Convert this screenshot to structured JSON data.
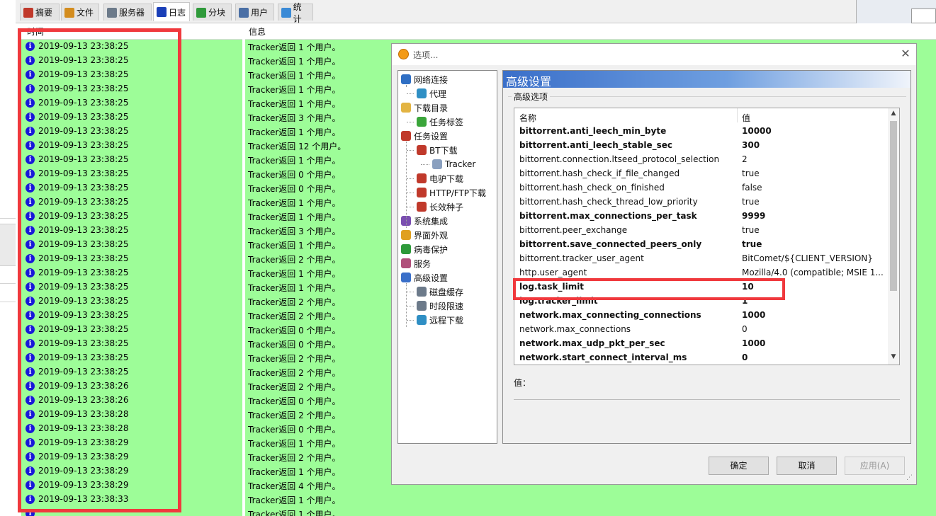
{
  "tabs": [
    {
      "label": "摘要",
      "icon": "checklist-icon",
      "color": "#c0392b"
    },
    {
      "label": "文件",
      "icon": "file-icon",
      "color": "#d38c1e"
    },
    {
      "label": "服务器",
      "icon": "server-icon",
      "color": "#6c7a8a"
    },
    {
      "label": "日志",
      "icon": "info-icon",
      "color": "#1a3fb8",
      "active": true
    },
    {
      "label": "分块",
      "icon": "pie-chart-icon",
      "color": "#2f9a3a"
    },
    {
      "label": "用户",
      "icon": "user-icon",
      "color": "#4a6fa5"
    },
    {
      "label": "统计",
      "icon": "stats-icon",
      "color": "#3a8ad6"
    }
  ],
  "log": {
    "columns": {
      "time": "时间",
      "message": "信息"
    },
    "rows": [
      {
        "time": "2019-09-13 23:38:25",
        "message": "Tracker返回 1 个用户。"
      },
      {
        "time": "2019-09-13 23:38:25",
        "message": "Tracker返回 1 个用户。"
      },
      {
        "time": "2019-09-13 23:38:25",
        "message": "Tracker返回 1 个用户。"
      },
      {
        "time": "2019-09-13 23:38:25",
        "message": "Tracker返回 1 个用户。"
      },
      {
        "time": "2019-09-13 23:38:25",
        "message": "Tracker返回 1 个用户。"
      },
      {
        "time": "2019-09-13 23:38:25",
        "message": "Tracker返回 3 个用户。"
      },
      {
        "time": "2019-09-13 23:38:25",
        "message": "Tracker返回 1 个用户。"
      },
      {
        "time": "2019-09-13 23:38:25",
        "message": "Tracker返回 12 个用户。"
      },
      {
        "time": "2019-09-13 23:38:25",
        "message": "Tracker返回 1 个用户。"
      },
      {
        "time": "2019-09-13 23:38:25",
        "message": "Tracker返回 0 个用户。"
      },
      {
        "time": "2019-09-13 23:38:25",
        "message": "Tracker返回 0 个用户。"
      },
      {
        "time": "2019-09-13 23:38:25",
        "message": "Tracker返回 1 个用户。"
      },
      {
        "time": "2019-09-13 23:38:25",
        "message": "Tracker返回 1 个用户。"
      },
      {
        "time": "2019-09-13 23:38:25",
        "message": "Tracker返回 3 个用户。"
      },
      {
        "time": "2019-09-13 23:38:25",
        "message": "Tracker返回 1 个用户。"
      },
      {
        "time": "2019-09-13 23:38:25",
        "message": "Tracker返回 2 个用户。"
      },
      {
        "time": "2019-09-13 23:38:25",
        "message": "Tracker返回 1 个用户。"
      },
      {
        "time": "2019-09-13 23:38:25",
        "message": "Tracker返回 1 个用户。"
      },
      {
        "time": "2019-09-13 23:38:25",
        "message": "Tracker返回 2 个用户。"
      },
      {
        "time": "2019-09-13 23:38:25",
        "message": "Tracker返回 2 个用户。"
      },
      {
        "time": "2019-09-13 23:38:25",
        "message": "Tracker返回 0 个用户。"
      },
      {
        "time": "2019-09-13 23:38:25",
        "message": "Tracker返回 0 个用户。"
      },
      {
        "time": "2019-09-13 23:38:25",
        "message": "Tracker返回 2 个用户。"
      },
      {
        "time": "2019-09-13 23:38:25",
        "message": "Tracker返回 2 个用户。"
      },
      {
        "time": "2019-09-13 23:38:26",
        "message": "Tracker返回 2 个用户。"
      },
      {
        "time": "2019-09-13 23:38:26",
        "message": "Tracker返回 0 个用户。"
      },
      {
        "time": "2019-09-13 23:38:28",
        "message": "Tracker返回 2 个用户。"
      },
      {
        "time": "2019-09-13 23:38:28",
        "message": "Tracker返回 0 个用户。"
      },
      {
        "time": "2019-09-13 23:38:29",
        "message": "Tracker返回 1 个用户。"
      },
      {
        "time": "2019-09-13 23:38:29",
        "message": "Tracker返回 2 个用户。"
      },
      {
        "time": "2019-09-13 23:38:29",
        "message": "Tracker返回 1 个用户。"
      },
      {
        "time": "2019-09-13 23:38:29",
        "message": "Tracker返回 4 个用户。"
      },
      {
        "time": "2019-09-13 23:38:33",
        "message": "Tracker返回 1 个用户。"
      },
      {
        "time": "",
        "message": "Tracker返回 1 个用户。"
      }
    ]
  },
  "dialog": {
    "title": "选项...",
    "close": "✕",
    "tree": [
      {
        "label": "网络连接",
        "icon": "network-icon",
        "color": "#2f6fc4"
      },
      {
        "label": "代理",
        "icon": "proxy-icon",
        "color": "#2f8fc4"
      },
      {
        "label": "下载目录",
        "icon": "folder-icon",
        "color": "#e3b443"
      },
      {
        "label": "任务标签",
        "icon": "tag-icon",
        "color": "#3aa53a"
      },
      {
        "label": "任务设置",
        "icon": "task-settings-icon",
        "color": "#c0392b"
      },
      {
        "label": "BT下载",
        "icon": "bt-download-icon",
        "color": "#c0392b"
      },
      {
        "label": "Tracker",
        "icon": "tracker-icon",
        "color": "#8aa0bf"
      },
      {
        "label": "电驴下载",
        "icon": "edonkey-icon",
        "color": "#c0392b"
      },
      {
        "label": "HTTP/FTP下载",
        "icon": "http-ftp-icon",
        "color": "#c0392b"
      },
      {
        "label": "长效种子",
        "icon": "long-seed-icon",
        "color": "#c0392b"
      },
      {
        "label": "系统集成",
        "icon": "system-integration-icon",
        "color": "#7a4fb0"
      },
      {
        "label": "界面外观",
        "icon": "appearance-icon",
        "color": "#e0a020"
      },
      {
        "label": "病毒保护",
        "icon": "shield-icon",
        "color": "#2e9a3a"
      },
      {
        "label": "服务",
        "icon": "service-icon",
        "color": "#b04f7a"
      },
      {
        "label": "高级设置",
        "icon": "advanced-settings-icon",
        "color": "#3a6fc9"
      },
      {
        "label": "磁盘缓存",
        "icon": "disk-cache-icon",
        "color": "#6c7a8a"
      },
      {
        "label": "时段限速",
        "icon": "time-limit-icon",
        "color": "#6c7a8a"
      },
      {
        "label": "远程下载",
        "icon": "remote-download-icon",
        "color": "#2f8fc4"
      }
    ],
    "panel": {
      "title": "高级设置",
      "group_label": "高级选项",
      "columns": {
        "name": "名称",
        "value": "值"
      },
      "rows": [
        {
          "name": "bittorrent.anti_leech_min_byte",
          "value": "10000",
          "bold": true
        },
        {
          "name": "bittorrent.anti_leech_stable_sec",
          "value": "300",
          "bold": true
        },
        {
          "name": "bittorrent.connection.ltseed_protocol_selection",
          "value": "2",
          "bold": false
        },
        {
          "name": "bittorrent.hash_check_if_file_changed",
          "value": "true",
          "bold": false
        },
        {
          "name": "bittorrent.hash_check_on_finished",
          "value": "false",
          "bold": false
        },
        {
          "name": "bittorrent.hash_check_thread_low_priority",
          "value": "true",
          "bold": false
        },
        {
          "name": "bittorrent.max_connections_per_task",
          "value": "9999",
          "bold": true
        },
        {
          "name": "bittorrent.peer_exchange",
          "value": "true",
          "bold": false
        },
        {
          "name": "bittorrent.save_connected_peers_only",
          "value": "true",
          "bold": true
        },
        {
          "name": "bittorrent.tracker_user_agent",
          "value": "BitComet/${CLIENT_VERSION}",
          "bold": false
        },
        {
          "name": "http.user_agent",
          "value": "Mozilla/4.0 (compatible; MSIE 1...",
          "bold": false
        },
        {
          "name": "log.task_limit",
          "value": "10",
          "bold": true
        },
        {
          "name": "log.tracker_limit",
          "value": "1",
          "bold": true
        },
        {
          "name": "network.max_connecting_connections",
          "value": "1000",
          "bold": true
        },
        {
          "name": "network.max_connections",
          "value": "0",
          "bold": false
        },
        {
          "name": "network.max_udp_pkt_per_sec",
          "value": "1000",
          "bold": true
        },
        {
          "name": "network.start_connect_interval_ms",
          "value": "0",
          "bold": true
        }
      ],
      "value_label": "值："
    },
    "buttons": {
      "ok": "确定",
      "cancel": "取消",
      "apply": "应用(A)"
    }
  }
}
